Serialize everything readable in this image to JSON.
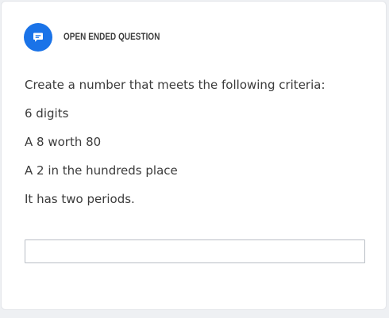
{
  "question": {
    "type_label": "OPEN ENDED QUESTION",
    "icon": "comment-icon",
    "accent_color": "#1a73e8",
    "lines": [
      "Create a number that meets the following criteria:",
      "6 digits",
      "A 8 worth 80",
      "A 2 in the hundreds place",
      "It has two periods."
    ]
  },
  "answer": {
    "value": "",
    "placeholder": ""
  }
}
